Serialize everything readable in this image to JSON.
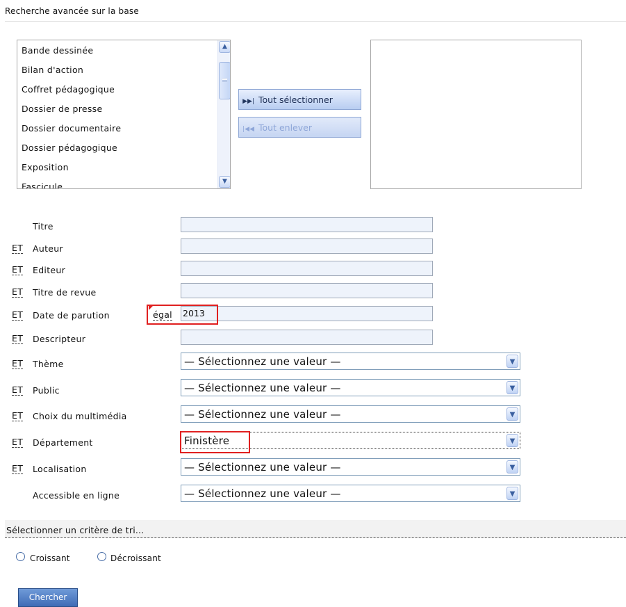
{
  "page_title": "Recherche avancée sur la base",
  "doc_types": {
    "options": [
      "Bande dessinée",
      "Bilan d'action",
      "Coffret pédagogique",
      "Dossier de presse",
      "Dossier documentaire",
      "Dossier pédagogique",
      "Exposition",
      "Fascicule"
    ],
    "select_all_label": "Tout sélectionner",
    "remove_all_label": "Tout enlever",
    "selected_items": []
  },
  "criteria": {
    "operator": "ET",
    "titre": {
      "label": "Titre",
      "value": ""
    },
    "auteur": {
      "label": "Auteur",
      "value": ""
    },
    "editeur": {
      "label": "Editeur",
      "value": ""
    },
    "titre_revue": {
      "label": "Titre de revue",
      "value": ""
    },
    "date_parution": {
      "label": "Date de parution",
      "comparator": "égal",
      "value": "2013"
    },
    "descripteur": {
      "label": "Descripteur",
      "value": ""
    },
    "theme": {
      "label": "Thème",
      "selected": "— Sélectionnez une valeur —"
    },
    "public": {
      "label": "Public",
      "selected": "— Sélectionnez une valeur —"
    },
    "multimedia": {
      "label": "Choix du multimédia",
      "selected": "— Sélectionnez une valeur —"
    },
    "departement": {
      "label": "Département",
      "selected": "Finistère"
    },
    "localisation": {
      "label": "Localisation",
      "selected": "— Sélectionnez une valeur —"
    },
    "accessible": {
      "label": "Accessible en ligne",
      "selected": "— Sélectionnez une valeur —"
    }
  },
  "sort": {
    "label": "Sélectionner un critère de tri...",
    "ascending": "Croissant",
    "descending": "Décroissant"
  },
  "search_button": "Chercher",
  "colors": {
    "highlight": "#e02020",
    "input_bg": "#eef3fb",
    "button": "#4a76bf"
  }
}
